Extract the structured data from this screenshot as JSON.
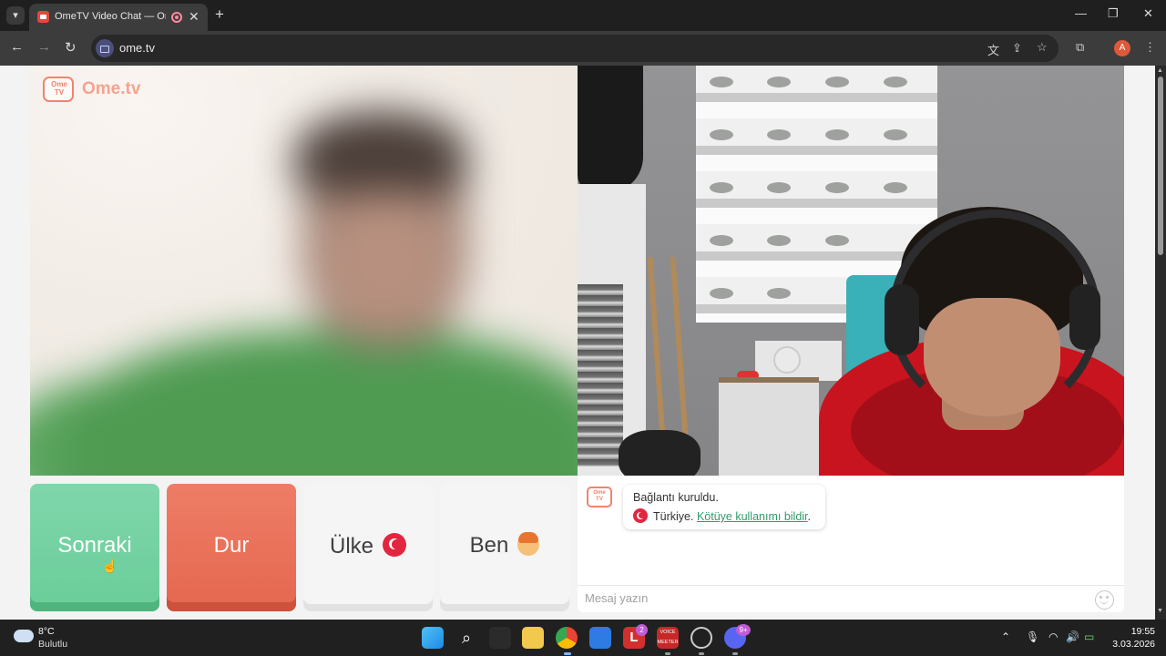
{
  "browser": {
    "tab_title": "OmeTV Video Chat — Ome",
    "tab_close": "✕",
    "new_tab": "+",
    "url": "ome.tv",
    "profile_initial": "A",
    "window_controls": {
      "minimize": "—",
      "maximize": "❐",
      "close": "✕"
    }
  },
  "brand": {
    "logo_badge": "Ome TV",
    "logo_text": "Ome.tv"
  },
  "controls": {
    "next_label": "Sonraki",
    "stop_label": "Dur",
    "country_label": "Ülke",
    "me_label": "Ben"
  },
  "chat": {
    "logo_badge": "Ome TV",
    "system_message": "Bağlantı kuruldu.",
    "country_name": "Türkiye.",
    "report_link": "Kötüye kullanımı bildir",
    "report_suffix": ".",
    "input_placeholder": "Mesaj yazın"
  },
  "taskbar": {
    "temperature": "8°C",
    "condition": "Bulutlu",
    "time": "19:55",
    "date": "3.03.2026",
    "badges": {
      "app_l": "2",
      "discord": "9+"
    },
    "voicemeeter_label": "VOICE MEETER"
  },
  "colors": {
    "next_button": "#6acd99",
    "stop_button": "#e5674f",
    "brand_accent": "#f0836e",
    "report_link": "#2d9c6a"
  }
}
